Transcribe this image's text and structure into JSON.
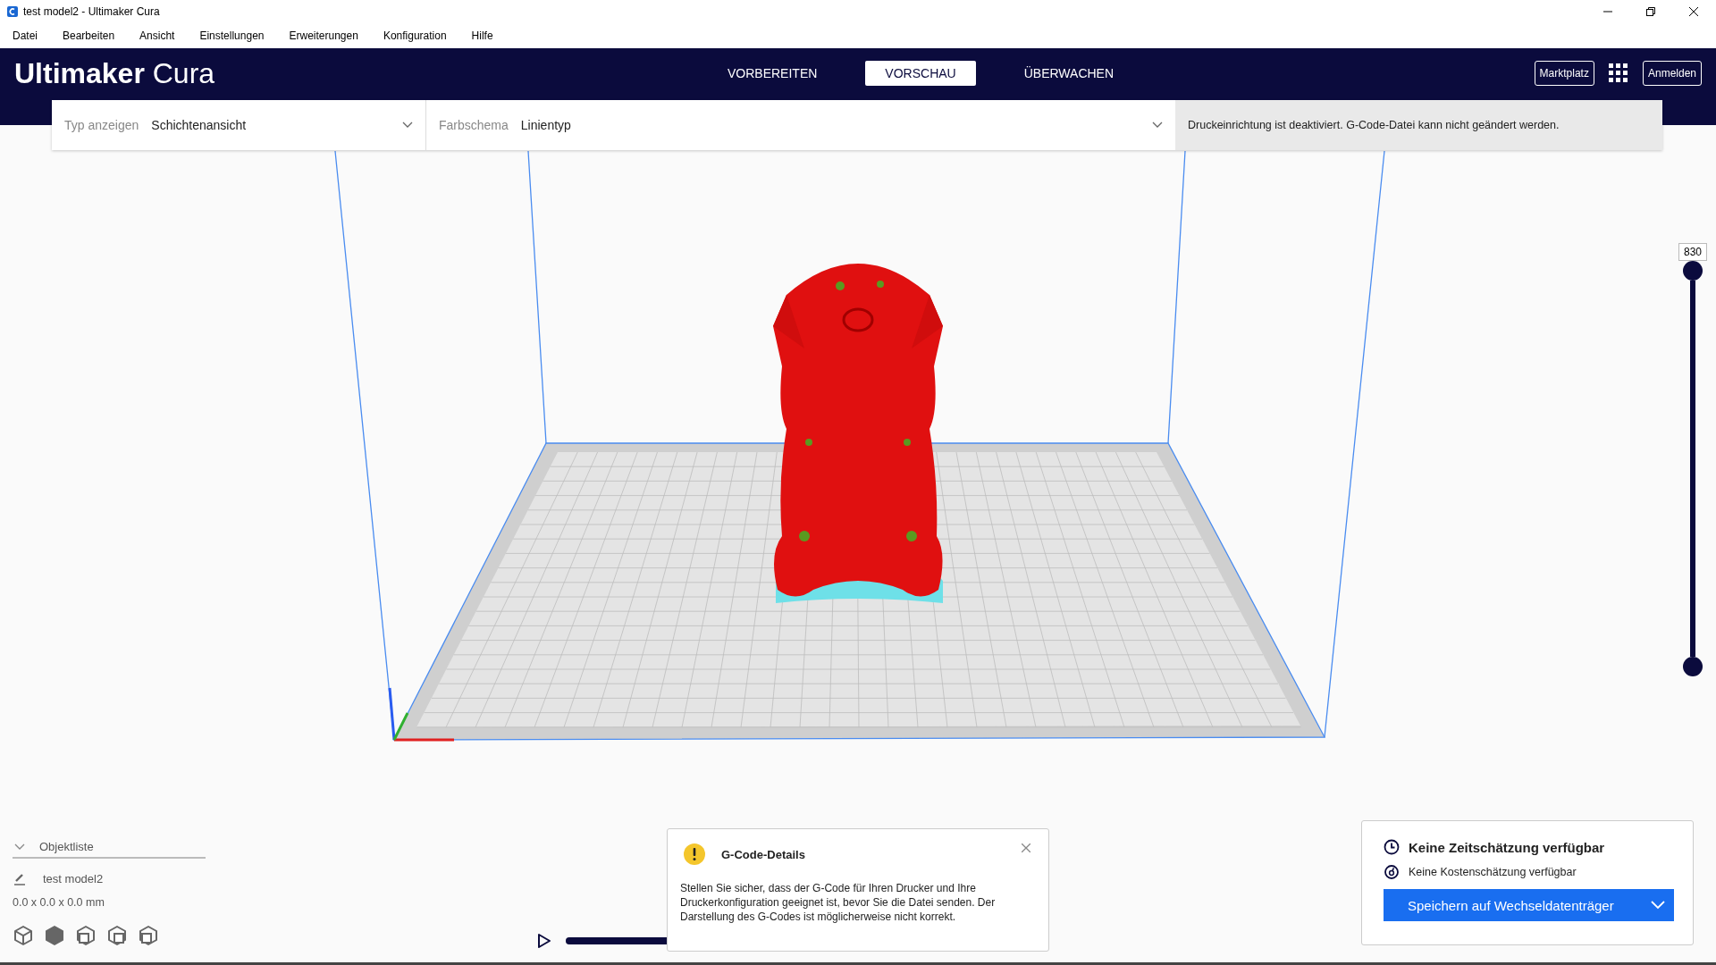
{
  "window": {
    "title": "test model2 - Ultimaker Cura"
  },
  "menu": [
    "Datei",
    "Bearbeiten",
    "Ansicht",
    "Einstellungen",
    "Erweiterungen",
    "Konfiguration",
    "Hilfe"
  ],
  "header": {
    "logo_bold": "Ultimaker",
    "logo_light": "Cura",
    "tabs": [
      {
        "label": "VORBEREITEN",
        "selected": false
      },
      {
        "label": "VORSCHAU",
        "selected": true
      },
      {
        "label": "ÜBERWACHEN",
        "selected": false
      }
    ],
    "buttons": [
      "Marktplatz",
      "Anmelden"
    ]
  },
  "view_bar": {
    "view_type_label": "Typ anzeigen",
    "view_type_value": "Schichtenansicht",
    "color_scheme_label": "Farbschema",
    "color_scheme_value": "Linientyp",
    "notice": "Druckeinrichtung ist deaktiviert. G-Code-Datei kann nicht geändert werden."
  },
  "layer_slider": {
    "reading": "830",
    "handles": [
      {
        "level": 1
      },
      {
        "level": 0
      }
    ]
  },
  "object_list": {
    "title": "Objektliste",
    "expanded": true,
    "items": [
      "test model2"
    ],
    "dimensions": "0.0 x 0.0 x 0.0 mm"
  },
  "playback": {
    "level": 1
  },
  "gcode_message": {
    "title": "G-Code-Details",
    "text": "Stellen Sie sicher, dass der G-Code für Ihren Drucker und Ihre Druckerkonfiguration geeignet ist, bevor Sie die Datei senden. Der Darstellung des G-Codes ist möglicherweise nicht korrekt."
  },
  "print_panel": {
    "time": "Keine Zeitschätzung verfügbar",
    "cost": "Keine Kostenschätzung verfügbar",
    "button": "Speichern auf Wechseldatenträger"
  }
}
